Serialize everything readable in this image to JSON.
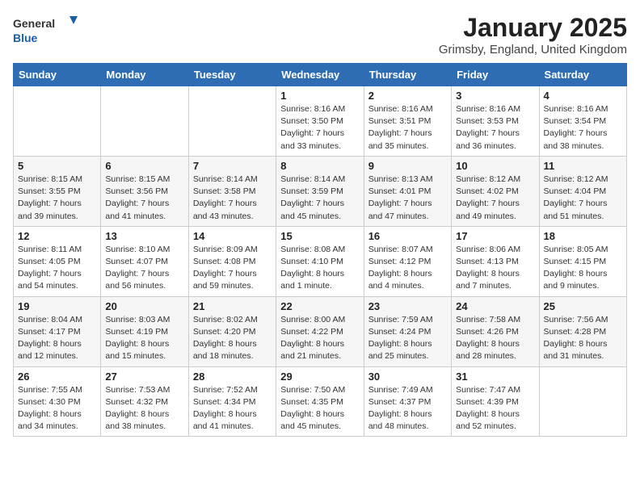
{
  "header": {
    "logo_line1": "General",
    "logo_line2": "Blue",
    "month_title": "January 2025",
    "subtitle": "Grimsby, England, United Kingdom"
  },
  "weekdays": [
    "Sunday",
    "Monday",
    "Tuesday",
    "Wednesday",
    "Thursday",
    "Friday",
    "Saturday"
  ],
  "weeks": [
    [
      {
        "day": "",
        "info": ""
      },
      {
        "day": "",
        "info": ""
      },
      {
        "day": "",
        "info": ""
      },
      {
        "day": "1",
        "info": "Sunrise: 8:16 AM\nSunset: 3:50 PM\nDaylight: 7 hours\nand 33 minutes."
      },
      {
        "day": "2",
        "info": "Sunrise: 8:16 AM\nSunset: 3:51 PM\nDaylight: 7 hours\nand 35 minutes."
      },
      {
        "day": "3",
        "info": "Sunrise: 8:16 AM\nSunset: 3:53 PM\nDaylight: 7 hours\nand 36 minutes."
      },
      {
        "day": "4",
        "info": "Sunrise: 8:16 AM\nSunset: 3:54 PM\nDaylight: 7 hours\nand 38 minutes."
      }
    ],
    [
      {
        "day": "5",
        "info": "Sunrise: 8:15 AM\nSunset: 3:55 PM\nDaylight: 7 hours\nand 39 minutes."
      },
      {
        "day": "6",
        "info": "Sunrise: 8:15 AM\nSunset: 3:56 PM\nDaylight: 7 hours\nand 41 minutes."
      },
      {
        "day": "7",
        "info": "Sunrise: 8:14 AM\nSunset: 3:58 PM\nDaylight: 7 hours\nand 43 minutes."
      },
      {
        "day": "8",
        "info": "Sunrise: 8:14 AM\nSunset: 3:59 PM\nDaylight: 7 hours\nand 45 minutes."
      },
      {
        "day": "9",
        "info": "Sunrise: 8:13 AM\nSunset: 4:01 PM\nDaylight: 7 hours\nand 47 minutes."
      },
      {
        "day": "10",
        "info": "Sunrise: 8:12 AM\nSunset: 4:02 PM\nDaylight: 7 hours\nand 49 minutes."
      },
      {
        "day": "11",
        "info": "Sunrise: 8:12 AM\nSunset: 4:04 PM\nDaylight: 7 hours\nand 51 minutes."
      }
    ],
    [
      {
        "day": "12",
        "info": "Sunrise: 8:11 AM\nSunset: 4:05 PM\nDaylight: 7 hours\nand 54 minutes."
      },
      {
        "day": "13",
        "info": "Sunrise: 8:10 AM\nSunset: 4:07 PM\nDaylight: 7 hours\nand 56 minutes."
      },
      {
        "day": "14",
        "info": "Sunrise: 8:09 AM\nSunset: 4:08 PM\nDaylight: 7 hours\nand 59 minutes."
      },
      {
        "day": "15",
        "info": "Sunrise: 8:08 AM\nSunset: 4:10 PM\nDaylight: 8 hours\nand 1 minute."
      },
      {
        "day": "16",
        "info": "Sunrise: 8:07 AM\nSunset: 4:12 PM\nDaylight: 8 hours\nand 4 minutes."
      },
      {
        "day": "17",
        "info": "Sunrise: 8:06 AM\nSunset: 4:13 PM\nDaylight: 8 hours\nand 7 minutes."
      },
      {
        "day": "18",
        "info": "Sunrise: 8:05 AM\nSunset: 4:15 PM\nDaylight: 8 hours\nand 9 minutes."
      }
    ],
    [
      {
        "day": "19",
        "info": "Sunrise: 8:04 AM\nSunset: 4:17 PM\nDaylight: 8 hours\nand 12 minutes."
      },
      {
        "day": "20",
        "info": "Sunrise: 8:03 AM\nSunset: 4:19 PM\nDaylight: 8 hours\nand 15 minutes."
      },
      {
        "day": "21",
        "info": "Sunrise: 8:02 AM\nSunset: 4:20 PM\nDaylight: 8 hours\nand 18 minutes."
      },
      {
        "day": "22",
        "info": "Sunrise: 8:00 AM\nSunset: 4:22 PM\nDaylight: 8 hours\nand 21 minutes."
      },
      {
        "day": "23",
        "info": "Sunrise: 7:59 AM\nSunset: 4:24 PM\nDaylight: 8 hours\nand 25 minutes."
      },
      {
        "day": "24",
        "info": "Sunrise: 7:58 AM\nSunset: 4:26 PM\nDaylight: 8 hours\nand 28 minutes."
      },
      {
        "day": "25",
        "info": "Sunrise: 7:56 AM\nSunset: 4:28 PM\nDaylight: 8 hours\nand 31 minutes."
      }
    ],
    [
      {
        "day": "26",
        "info": "Sunrise: 7:55 AM\nSunset: 4:30 PM\nDaylight: 8 hours\nand 34 minutes."
      },
      {
        "day": "27",
        "info": "Sunrise: 7:53 AM\nSunset: 4:32 PM\nDaylight: 8 hours\nand 38 minutes."
      },
      {
        "day": "28",
        "info": "Sunrise: 7:52 AM\nSunset: 4:34 PM\nDaylight: 8 hours\nand 41 minutes."
      },
      {
        "day": "29",
        "info": "Sunrise: 7:50 AM\nSunset: 4:35 PM\nDaylight: 8 hours\nand 45 minutes."
      },
      {
        "day": "30",
        "info": "Sunrise: 7:49 AM\nSunset: 4:37 PM\nDaylight: 8 hours\nand 48 minutes."
      },
      {
        "day": "31",
        "info": "Sunrise: 7:47 AM\nSunset: 4:39 PM\nDaylight: 8 hours\nand 52 minutes."
      },
      {
        "day": "",
        "info": ""
      }
    ]
  ]
}
